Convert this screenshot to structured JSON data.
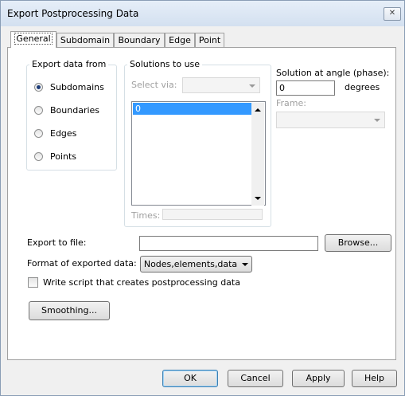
{
  "window": {
    "title": "Export Postprocessing Data",
    "close_symbol": "✕"
  },
  "tabs": [
    {
      "label": "General"
    },
    {
      "label": "Subdomain"
    },
    {
      "label": "Boundary"
    },
    {
      "label": "Edge"
    },
    {
      "label": "Point"
    }
  ],
  "active_tab": "General",
  "export_from": {
    "legend": "Export data from",
    "options": [
      {
        "label": "Subdomains",
        "selected": true
      },
      {
        "label": "Boundaries",
        "selected": false
      },
      {
        "label": "Edges",
        "selected": false
      },
      {
        "label": "Points",
        "selected": false
      }
    ]
  },
  "solutions": {
    "legend": "Solutions to use",
    "select_via_label": "Select via:",
    "select_via_value": "",
    "list_items": [
      "0"
    ],
    "times_label": "Times:",
    "times_value": ""
  },
  "angle": {
    "label": "Solution at angle (phase):",
    "value": "0",
    "unit": "degrees",
    "frame_label": "Frame:",
    "frame_value": ""
  },
  "export_file": {
    "label": "Export to file:",
    "value": "",
    "browse_label": "Browse..."
  },
  "format": {
    "label": "Format of exported data:",
    "value": "Nodes,elements,data"
  },
  "script_checkbox": {
    "label": "Write script that creates postprocessing data",
    "checked": false
  },
  "smoothing_label": "Smoothing...",
  "buttons": {
    "ok": "OK",
    "cancel": "Cancel",
    "apply": "Apply",
    "help": "Help"
  }
}
